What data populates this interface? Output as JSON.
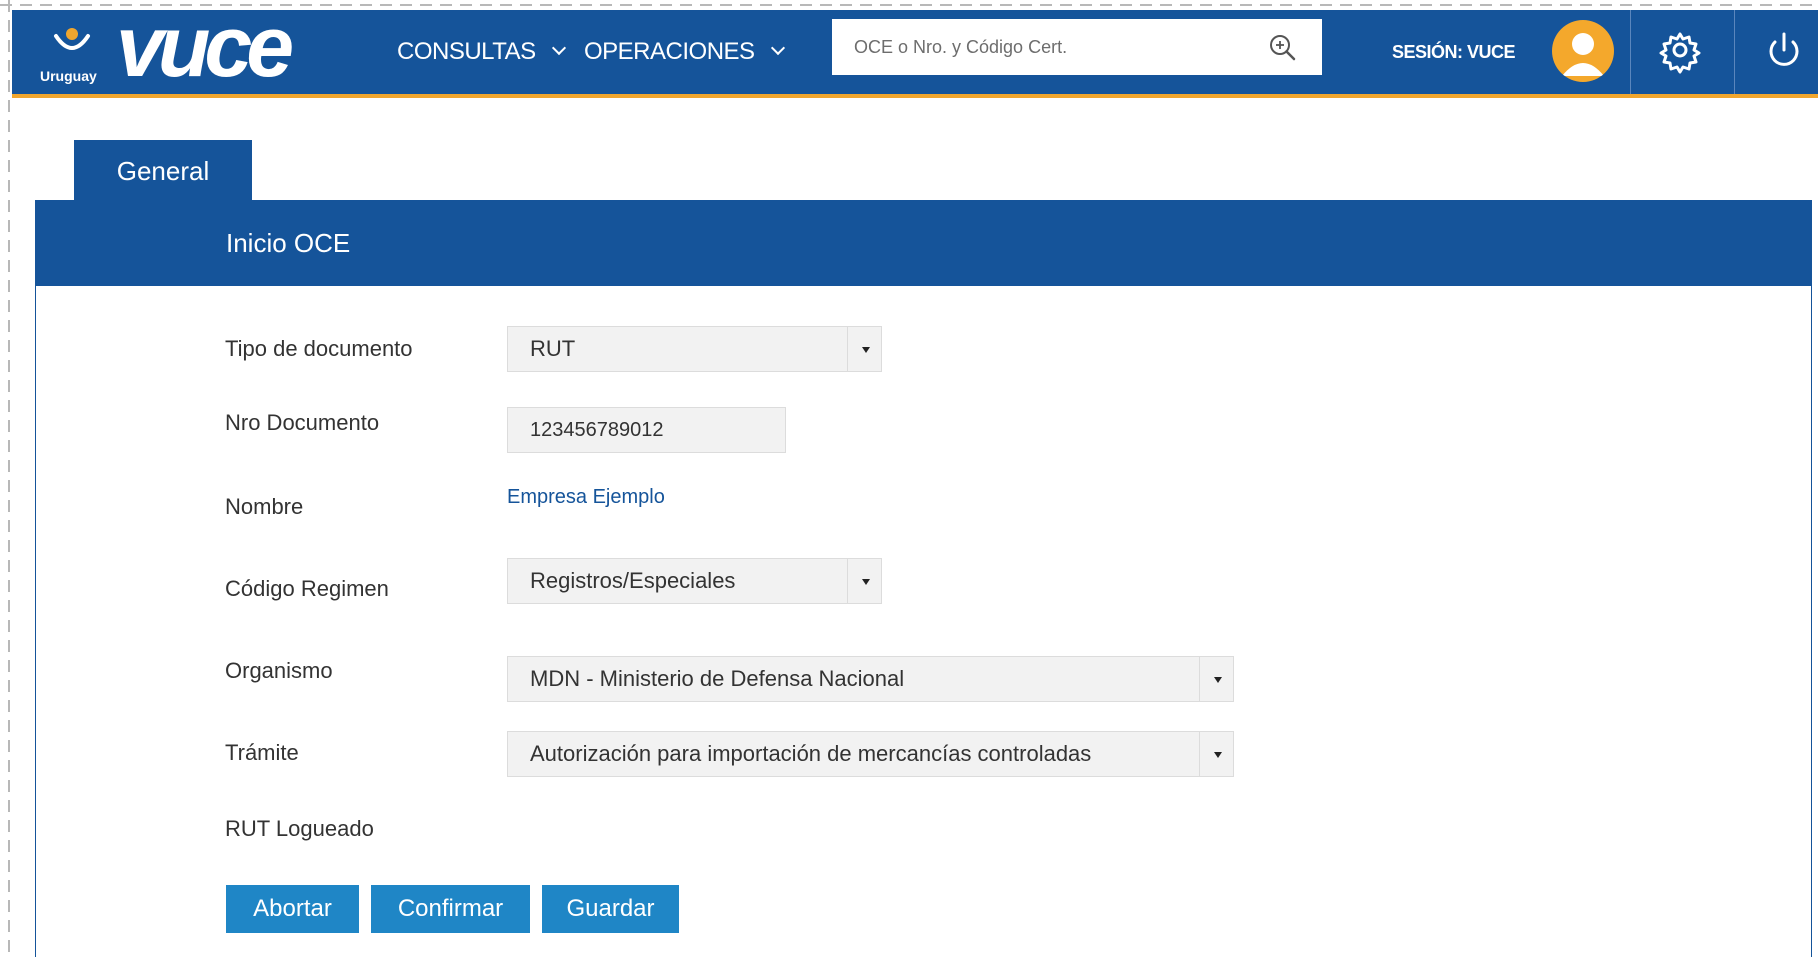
{
  "brand": {
    "country": "Uruguay",
    "wordmark": "vuce",
    "primary_color": "#15549a",
    "accent_color": "#f0a62e",
    "button_color": "#1f86c6"
  },
  "header": {
    "menus": [
      {
        "label": "CONSULTAS",
        "icon": "chevron-down-icon"
      },
      {
        "label": "OPERACIONES",
        "icon": "chevron-down-icon"
      }
    ],
    "search": {
      "placeholder": "OCE o Nro. y Código Cert.",
      "value": "",
      "icon": "zoom-in-icon"
    },
    "session_label": "SESIÓN: VUCE",
    "icons": [
      "avatar-icon",
      "gear-icon",
      "power-icon"
    ]
  },
  "tabs": [
    {
      "label": "General",
      "active": true
    }
  ],
  "panel": {
    "title": "Inicio OCE"
  },
  "form": {
    "tipo_documento": {
      "label": "Tipo de documento",
      "value": "RUT"
    },
    "nro_documento": {
      "label": "Nro Documento",
      "value": "123456789012"
    },
    "nombre": {
      "label": "Nombre",
      "value": "Empresa Ejemplo"
    },
    "codigo_regimen": {
      "label": "Código Regimen",
      "value": "Registros/Especiales"
    },
    "organismo": {
      "label": "Organismo",
      "value": "MDN - Ministerio de Defensa Nacional"
    },
    "tramite": {
      "label": "Trámite",
      "value": "Autorización para importación de mercancías controladas"
    },
    "rut_logueado": {
      "label": "RUT Logueado",
      "value": ""
    }
  },
  "actions": {
    "abort": "Abortar",
    "confirm": "Confirmar",
    "save": "Guardar"
  }
}
